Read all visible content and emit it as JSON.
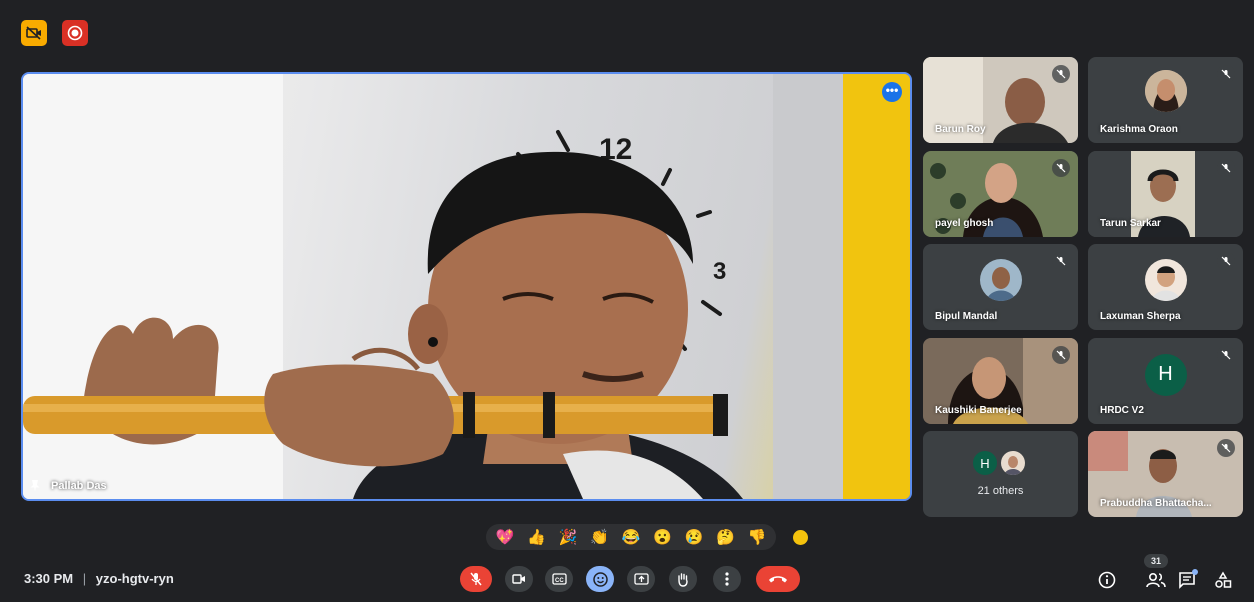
{
  "top_indicators": [
    {
      "name": "camera-off-indicator",
      "icon": "camera-off-icon",
      "color": "#f9ab00"
    },
    {
      "name": "recording-indicator",
      "icon": "record-icon",
      "color": "#d93025"
    }
  ],
  "main_stage": {
    "presenter_name": "Pallab Das",
    "pin_icon": "pin-icon",
    "options_icon": "more-horiz-icon",
    "clock_numbers": [
      "12",
      "3"
    ]
  },
  "participants": [
    {
      "name": "Barun Roy",
      "muted": true
    },
    {
      "name": "Karishma Oraon",
      "muted": true
    },
    {
      "name": "payel ghosh",
      "muted": true
    },
    {
      "name": "Tarun Sarkar",
      "muted": true
    },
    {
      "name": "Bipul Mandal",
      "muted": true
    },
    {
      "name": "Laxuman Sherpa",
      "muted": true
    },
    {
      "name": "Kaushiki Banerjee",
      "muted": true
    },
    {
      "name": "HRDC V2",
      "muted": true,
      "initial": "H"
    },
    {
      "name": "21 others",
      "initial": "H"
    },
    {
      "name": "Prabuddha Bhattacha...",
      "muted": true
    }
  ],
  "reactions": [
    "💖",
    "👍",
    "🎉",
    "👏",
    "😂",
    "😮",
    "😢",
    "🤔",
    "👎"
  ],
  "reaction_skin_tone_color": "#f4c20d",
  "meeting": {
    "time": "3:30 PM",
    "separator": "|",
    "code": "yzo-hgtv-ryn"
  },
  "controls": [
    {
      "name": "mic-off-button",
      "icon": "mic-off-icon",
      "color": "#ea4335"
    },
    {
      "name": "camera-button",
      "icon": "camera-icon",
      "color": "#3c4043"
    },
    {
      "name": "captions-button",
      "icon": "captions-icon",
      "color": "#3c4043"
    },
    {
      "name": "reactions-button",
      "icon": "emoji-icon",
      "color": "#8ab4f8"
    },
    {
      "name": "present-button",
      "icon": "present-icon",
      "color": "#3c4043"
    },
    {
      "name": "raise-hand-button",
      "icon": "hand-icon",
      "color": "#3c4043"
    },
    {
      "name": "more-options-button",
      "icon": "more-vert-icon",
      "color": "#3c4043"
    },
    {
      "name": "leave-call-button",
      "icon": "hangup-icon",
      "color": "#ea4335"
    }
  ],
  "right_controls": {
    "people_count": "31",
    "items": [
      {
        "name": "meeting-details-button",
        "icon": "info-icon"
      },
      {
        "name": "people-button",
        "icon": "people-icon"
      },
      {
        "name": "chat-button",
        "icon": "chat-icon"
      },
      {
        "name": "activities-button",
        "icon": "activities-icon"
      }
    ]
  }
}
